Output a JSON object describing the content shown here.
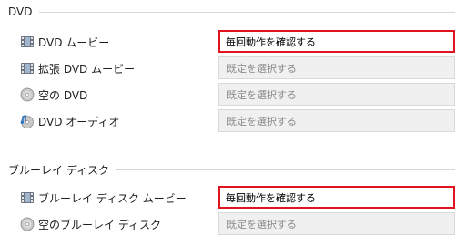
{
  "dvd_section": {
    "title": "DVD",
    "items": [
      {
        "label": "DVD ムービー",
        "icon": "dvd-movie-icon",
        "value": "毎回動作を確認する",
        "active": true
      },
      {
        "label": "拡張 DVD ムービー",
        "icon": "enhanced-dvd-movie-icon",
        "value": "既定を選択する",
        "active": false
      },
      {
        "label": "空の DVD",
        "icon": "blank-disc-icon",
        "value": "既定を選択する",
        "active": false
      },
      {
        "label": "DVD オーディオ",
        "icon": "dvd-audio-icon",
        "value": "既定を選択する",
        "active": false
      }
    ]
  },
  "bluray_section": {
    "title": "ブルーレイ ディスク",
    "items": [
      {
        "label": "ブルーレイ ディスク ムービー",
        "icon": "bluray-movie-icon",
        "value": "毎回動作を確認する",
        "active": true
      },
      {
        "label": "空のブルーレイ ディスク",
        "icon": "blank-disc-icon",
        "value": "既定を選択する",
        "active": false
      }
    ]
  },
  "colors": {
    "highlight": "#e0141e",
    "disabled_bg": "#f0f0f0"
  }
}
